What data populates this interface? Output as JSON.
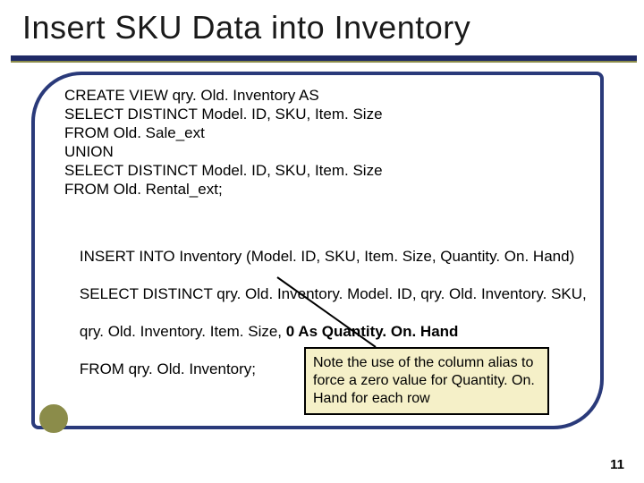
{
  "title": "Insert SKU Data into Inventory",
  "code_block_1": "CREATE VIEW qry. Old. Inventory AS\nSELECT DISTINCT Model. ID, SKU, Item. Size\nFROM Old. Sale_ext\nUNION\nSELECT DISTINCT Model. ID, SKU, Item. Size\nFROM Old. Rental_ext;",
  "code_block_2_line1": "INSERT INTO Inventory (Model. ID, SKU, Item. Size, Quantity. On. Hand)",
  "code_block_2_line2": "SELECT DISTINCT qry. Old. Inventory. Model. ID, qry. Old. Inventory. SKU,",
  "code_block_2_line3_prefix": "qry. Old. Inventory. Item. Size, ",
  "code_block_2_line3_bold": "0 As Quantity. On. Hand",
  "code_block_2_line4": "FROM qry. Old. Inventory;",
  "note_text": "Note the use of the column alias to force a zero value for Quantity. On. Hand for each row",
  "page_number": "11"
}
